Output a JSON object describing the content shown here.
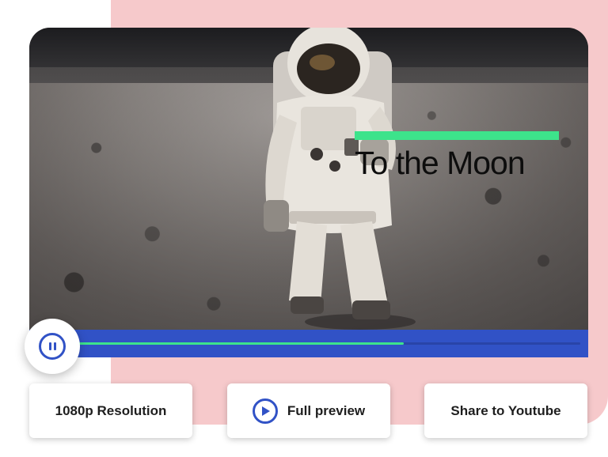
{
  "video": {
    "title": "To the Moon",
    "playback_progress": 0.65,
    "state": "playing"
  },
  "controls": {
    "pause_icon": "pause-icon"
  },
  "actions": {
    "resolution_label": "1080p Resolution",
    "preview_label": "Full preview",
    "preview_icon": "play-icon",
    "share_label": "Share to Youtube"
  },
  "colors": {
    "accent_blue": "#3152c6",
    "accent_green": "#3de38b",
    "background_pink": "#f6c9cb"
  }
}
